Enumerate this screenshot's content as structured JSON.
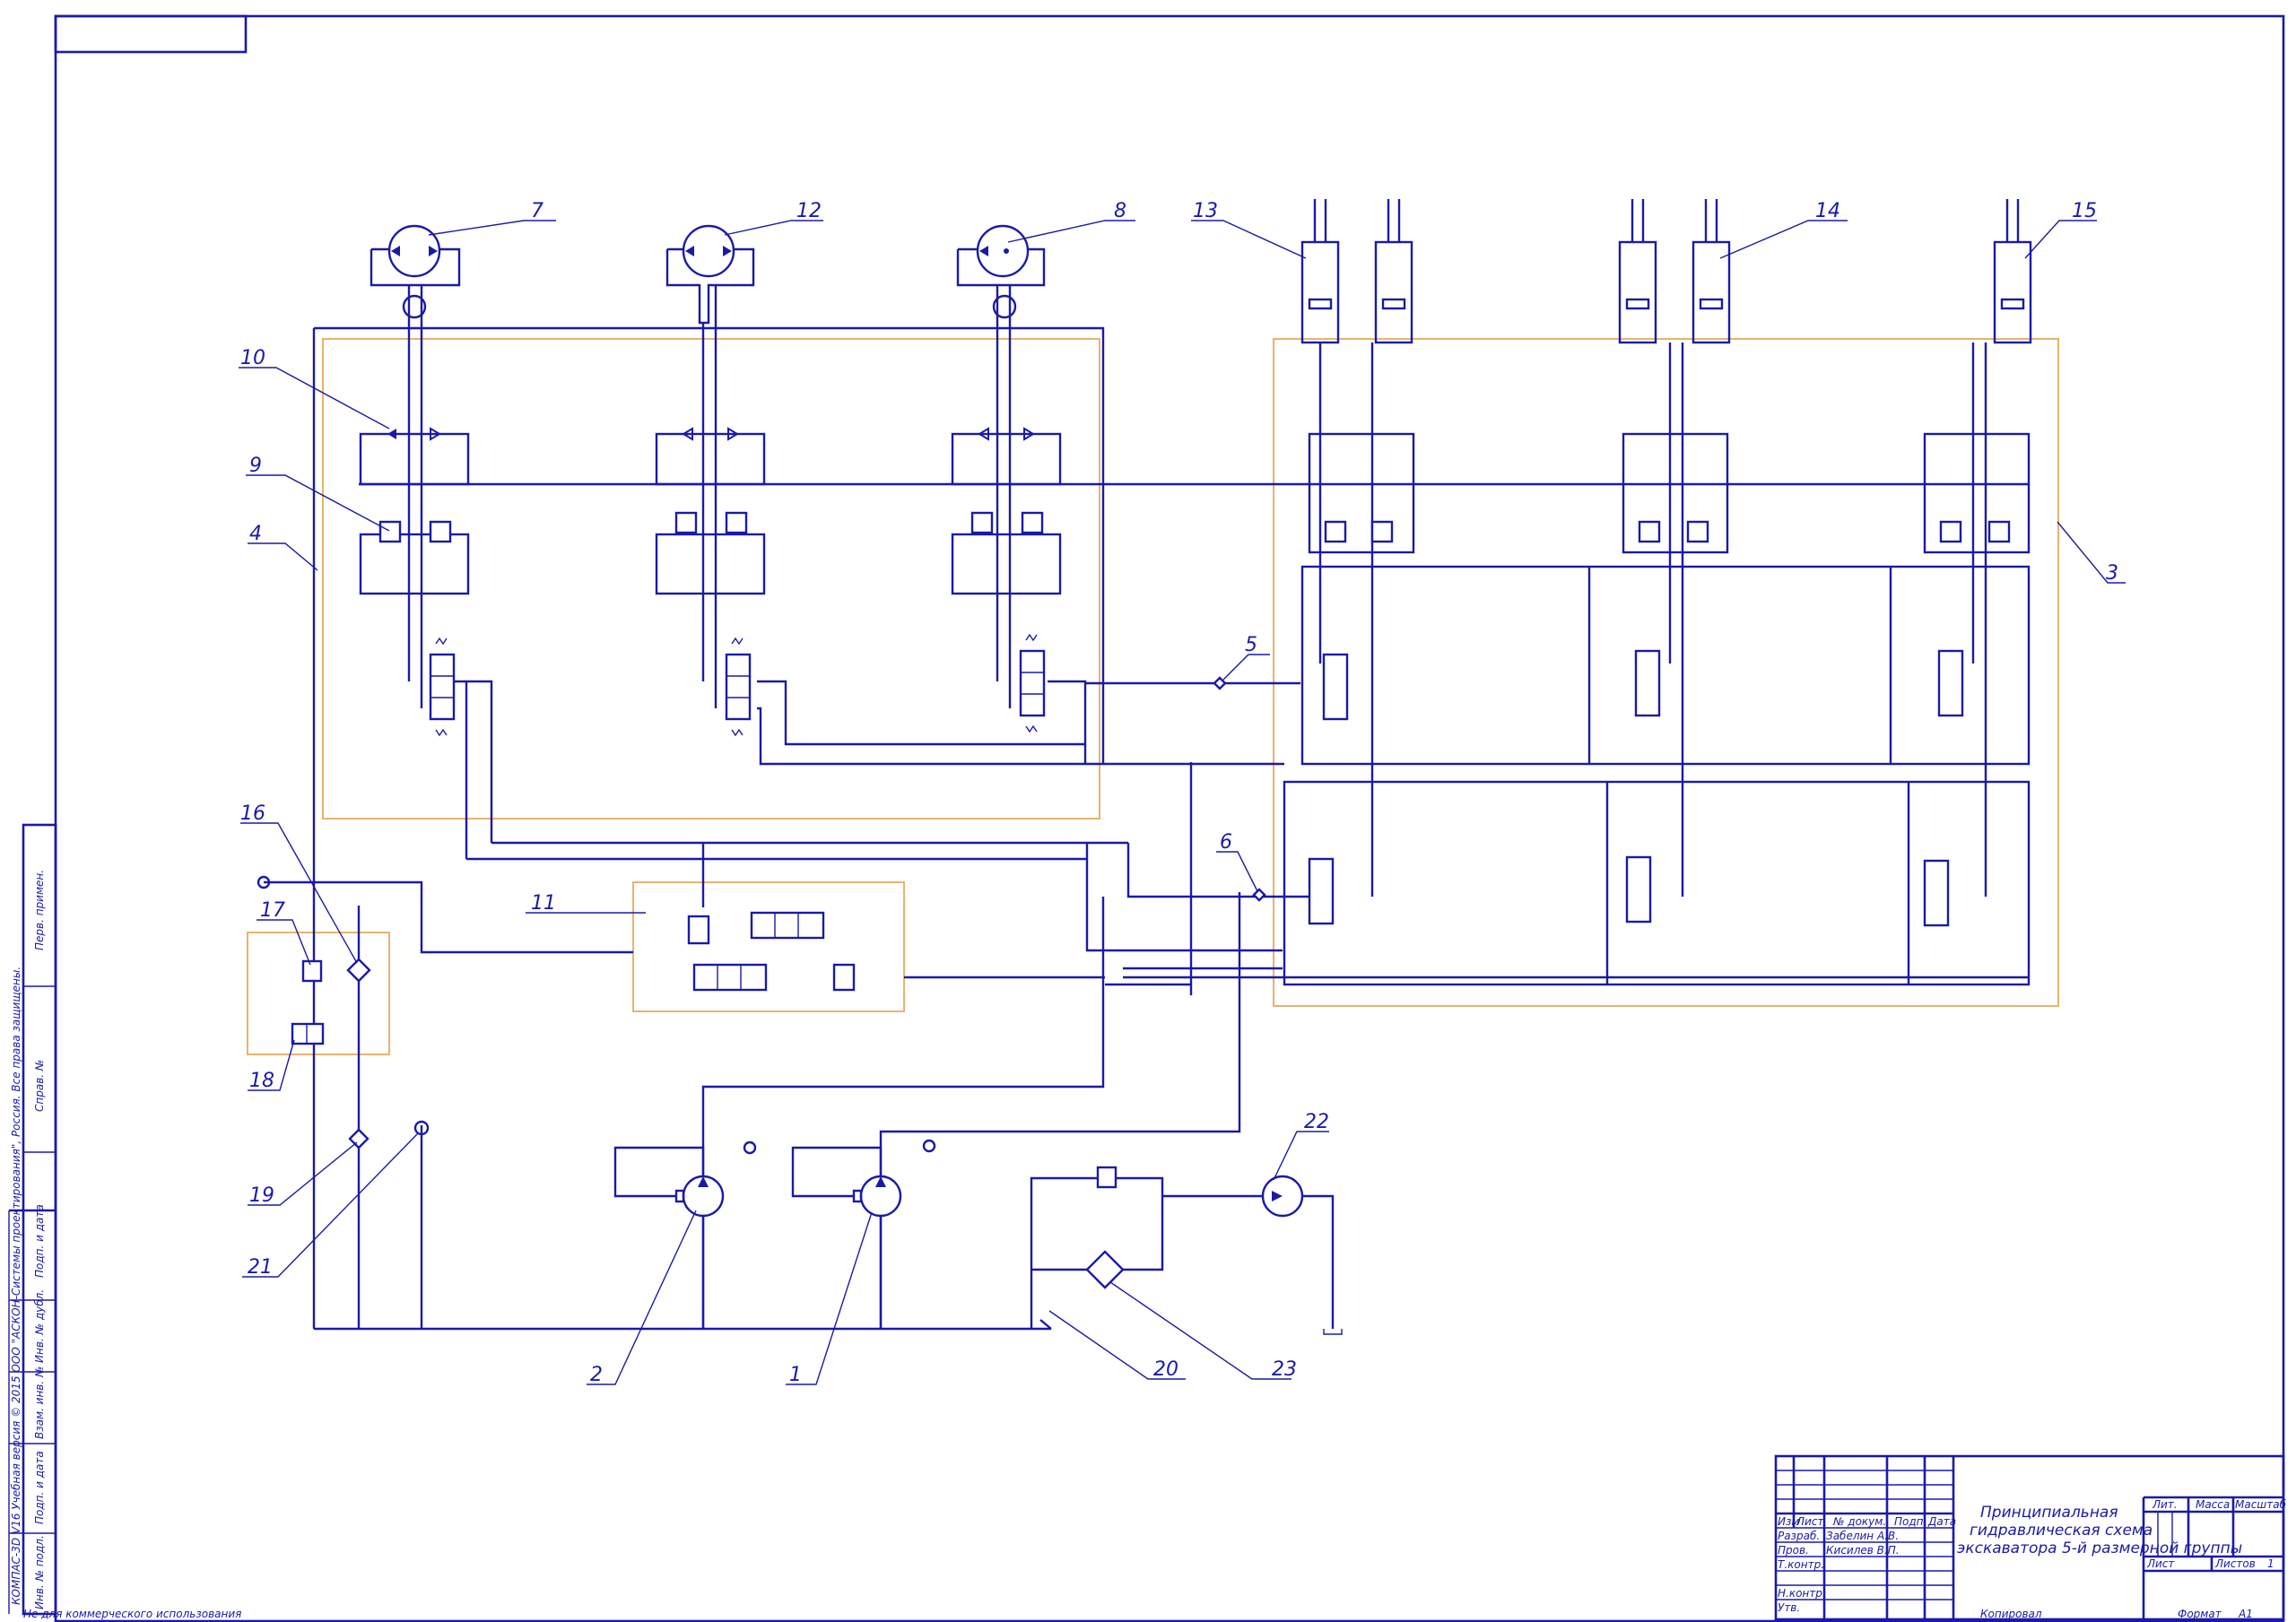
{
  "labels": {
    "l1": "1",
    "l2": "2",
    "l3": "3",
    "l4": "4",
    "l5": "5",
    "l6": "6",
    "l7": "7",
    "l8": "8",
    "l9": "9",
    "l10": "10",
    "l11": "11",
    "l12": "12",
    "l13": "13",
    "l14": "14",
    "l15": "15",
    "l16": "16",
    "l17": "17",
    "l18": "18",
    "l19": "19",
    "l20": "20",
    "l21": "21",
    "l22": "22",
    "l23": "23"
  },
  "title_block": {
    "title_line1": "Принципиальная",
    "title_line2": "гидравлическая схема",
    "title_line3": "экскаватора 5-й размерной группы",
    "col_izm": "Изм",
    "col_list": "Лист",
    "col_ndoc": "№ докум.",
    "col_podp": "Подп.",
    "col_data": "Дата",
    "row_razrab": "Разраб.",
    "row_prov": "Пров.",
    "row_tkontr": "Т.контр.",
    "row_nkontr": "Н.контр.",
    "row_utv": "Утв.",
    "razrab_name": "Забелин А.В.",
    "prov_name": "Кисилев В.П.",
    "lit": "Лит.",
    "massa": "Масса",
    "masshtab": "Масштаб",
    "list": "Лист",
    "listov": "Листов",
    "listov_value": "1",
    "copied": "Копировал",
    "format": "Формат",
    "format_value": "А1"
  },
  "side_stamp": {
    "perv_primen": "Перв. примен.",
    "sprav_no": "Справ. №",
    "podp_data_1": "Подп. и дата",
    "inv_dubl": "Инв. № дубл.",
    "vzam_inv": "Взам. инв. №",
    "podp_data_2": "Подп. и дата",
    "inv_podl": "Инв. № подл.",
    "license": "КОМПАС-3D V16 Учебная версия © 2015 ООО \"АСКОН-Системы проектирования\", Россия. Все права защищены."
  },
  "footer_note": "Не для коммерческого использования"
}
